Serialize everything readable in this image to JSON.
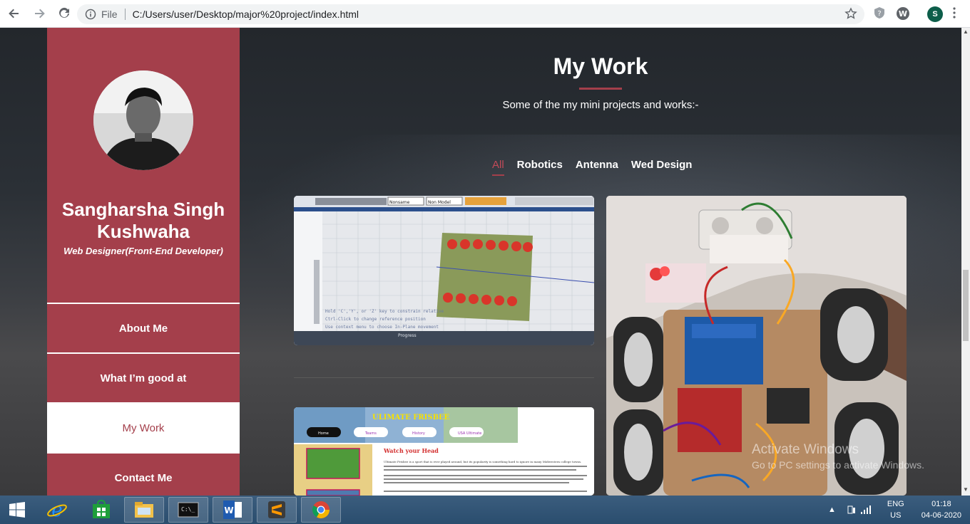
{
  "browser": {
    "file_label": "File",
    "url": "C:/Users/user/Desktop/major%20project/index.html",
    "profile_initial": "S"
  },
  "sidebar": {
    "name": "Sangharsha Singh Kushwaha",
    "role": "Web Designer(Front-End Developer)",
    "menu": [
      {
        "label": "About Me"
      },
      {
        "label": "What I’m good at"
      },
      {
        "label": "My Work",
        "active": true
      },
      {
        "label": "Contact Me"
      }
    ]
  },
  "main": {
    "title": "My Work",
    "subtitle": "Some of the my mini projects and works:-",
    "filters": [
      {
        "label": "All",
        "active": true
      },
      {
        "label": "Robotics"
      },
      {
        "label": "Antenna"
      },
      {
        "label": "Wed Design"
      }
    ],
    "cards": {
      "antenna": {
        "dropdown1": "Nonsame",
        "dropdown2": "Non Model",
        "help1": "Hold 'C','Y', or 'Z' key to constrain relative",
        "help2": "Ctrl-Click to change reference position",
        "help3": "Use context menu to choose In-Plane movement",
        "progress": "Progress"
      },
      "frisbee": {
        "banner": "ULIMATE FRISBEE",
        "nav": [
          "Home",
          "Teams",
          "History",
          "USA Ultimate"
        ],
        "heading": "Watch your Head",
        "body": "Ultimate Frisbee is a sport that is ever played around, but its popularity is something hard to ignore in many Midwestern college towns."
      }
    }
  },
  "watermark": {
    "line1": "Activate Windows",
    "line2": "Go to PC settings to activate Windows."
  },
  "taskbar": {
    "lang": "ENG",
    "region": "US",
    "time": "01:18",
    "date": "04-06-2020"
  },
  "colors": {
    "accent": "#a43f4b",
    "background": "#2a2e33"
  }
}
